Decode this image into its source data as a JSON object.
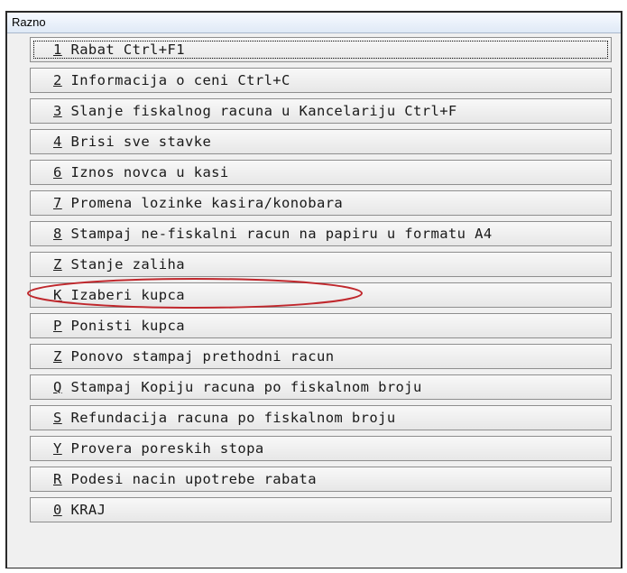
{
  "window": {
    "title": "Razno"
  },
  "menu": {
    "items": [
      {
        "key": "1",
        "label": "Rabat Ctrl+F1"
      },
      {
        "key": "2",
        "label": "Informacija o ceni Ctrl+C"
      },
      {
        "key": "3",
        "label": "Slanje fiskalnog racuna u Kancelariju Ctrl+F"
      },
      {
        "key": "4",
        "label": "Brisi sve stavke"
      },
      {
        "key": "6",
        "label": "Iznos novca u kasi"
      },
      {
        "key": "7",
        "label": "Promena lozinke kasira/konobara"
      },
      {
        "key": "8",
        "label": "Stampaj ne-fiskalni racun na papiru u formatu A4"
      },
      {
        "key": "Z",
        "label": "Stanje zaliha"
      },
      {
        "key": "K",
        "label": "Izaberi kupca"
      },
      {
        "key": "P",
        "label": "Ponisti kupca"
      },
      {
        "key": "Z",
        "label": "Ponovo stampaj prethodni racun"
      },
      {
        "key": "Q",
        "label": "Stampaj Kopiju racuna po fiskalnom broju"
      },
      {
        "key": "S",
        "label": "Refundacija racuna po fiskalnom broju"
      },
      {
        "key": "Y",
        "label": "Provera poreskih stopa"
      },
      {
        "key": "R",
        "label": "Podesi nacin upotrebe rabata"
      },
      {
        "key": "0",
        "label": "KRAJ"
      }
    ]
  },
  "annotation": {
    "color": "#c0282d"
  }
}
